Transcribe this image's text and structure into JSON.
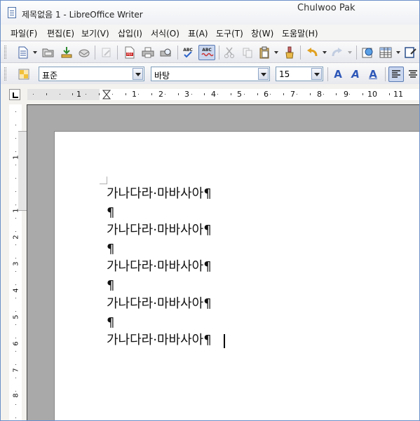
{
  "window": {
    "title": "제목없음 1 - LibreOffice Writer",
    "user": "Chulwoo Pak"
  },
  "menu": [
    "파일(F)",
    "편집(E)",
    "보기(V)",
    "삽입(I)",
    "서식(O)",
    "표(A)",
    "도구(T)",
    "창(W)",
    "도움말(H)"
  ],
  "toolbar_standard": {
    "icons": [
      "new-document-icon",
      "open-icon",
      "save-icon",
      "email-icon",
      "edit-mode-icon",
      "export-pdf-icon",
      "print-icon",
      "print-preview-icon",
      "spellcheck-icon",
      "auto-spellcheck-icon",
      "cut-icon",
      "copy-icon",
      "paste-icon",
      "clone-format-icon",
      "undo-icon",
      "redo-icon",
      "navigator-icon",
      "table-icon",
      "show-draw-functions-icon"
    ],
    "spellcheck_label": "ABC"
  },
  "toolbar_formatting": {
    "paragraph_style": "표준",
    "font_name": "바탕",
    "font_size": "15",
    "icons": [
      "styles-icon",
      "font-bold-effect-icon",
      "font-italic-effect-icon",
      "font-underline-effect-icon",
      "align-left-icon",
      "align-center-icon"
    ]
  },
  "ruler": {
    "horizontal_numbers": [
      "1",
      "1",
      "2",
      "3",
      "4",
      "5",
      "6",
      "7",
      "8",
      "9",
      "10",
      "11"
    ],
    "vertical_numbers": [
      "1",
      "1",
      "2",
      "3",
      "4",
      "5",
      "6",
      "7",
      "8"
    ],
    "unit": "cm"
  },
  "document": {
    "lines": [
      "가나다라·마바사아¶",
      "¶",
      "가나다라·마바사아¶",
      "¶",
      "가나다라·마바사아¶",
      "¶",
      "가나다라·마바사아¶",
      "¶",
      "가나다라·마바사아¶"
    ]
  }
}
